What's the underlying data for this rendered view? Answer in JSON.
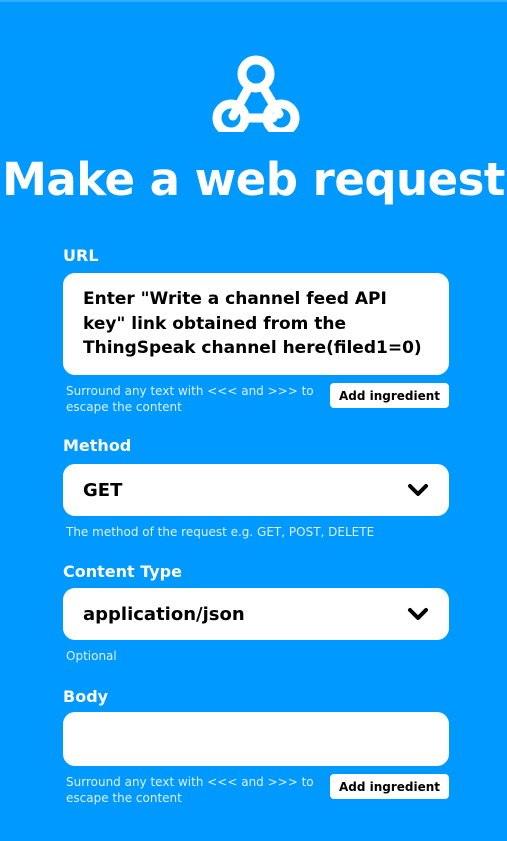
{
  "title": "Make a web request",
  "logo_icon": "webhook-icon",
  "url": {
    "label": "URL",
    "value": "Enter \"Write a channel feed API key\" link obtained from the ThingSpeak channel here(filed1=0)",
    "help_line1": "Surround any text with <<< and >>> to",
    "help_line2": "escape the content",
    "add_ingredient": "Add ingredient"
  },
  "method": {
    "label": "Method",
    "value": "GET",
    "help": "The method of the request e.g. GET, POST, DELETE"
  },
  "content_type": {
    "label": "Content Type",
    "value": "application/json",
    "help": "Optional"
  },
  "body": {
    "label": "Body",
    "value": "",
    "help_line1": "Surround any text with <<< and >>> to",
    "help_line2": "escape the content",
    "add_ingredient": "Add ingredient"
  },
  "colors": {
    "background": "#0099FF",
    "field": "#FFFFFF"
  }
}
